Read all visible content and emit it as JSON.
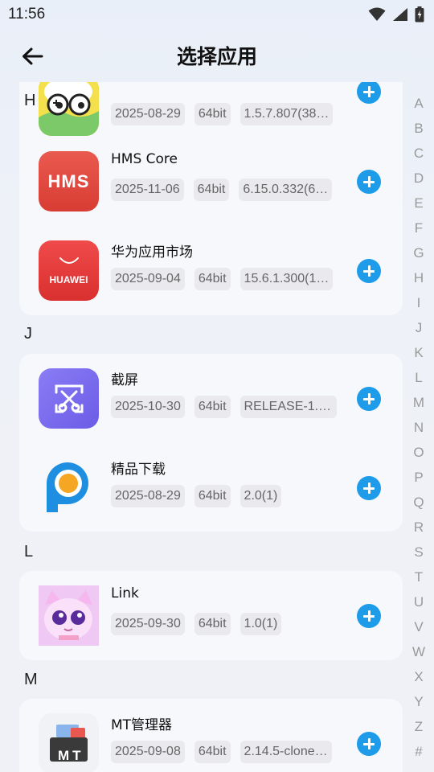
{
  "status": {
    "time": "11:56"
  },
  "header": {
    "title": "选择应用"
  },
  "sections": [
    {
      "letter": "H"
    },
    {
      "letter": "J"
    },
    {
      "letter": "L"
    },
    {
      "letter": "M"
    }
  ],
  "apps": [
    {
      "name": "",
      "date": "2025-08-29",
      "arch": "64bit",
      "version": "1.5.7.807(38…"
    },
    {
      "name": "HMS Core",
      "date": "2025-11-06",
      "arch": "64bit",
      "version": "6.15.0.332(6…",
      "icon_text": "HMS"
    },
    {
      "name": "华为应用市场",
      "date": "2025-09-04",
      "arch": "64bit",
      "version": "15.6.1.300(1…",
      "icon_text": "HUAWEI"
    },
    {
      "name": "截屏",
      "date": "2025-10-30",
      "arch": "64bit",
      "version": "RELEASE-1.6…"
    },
    {
      "name": "精品下载",
      "date": "2025-08-29",
      "arch": "64bit",
      "version": "2.0(1)"
    },
    {
      "name": "Link",
      "date": "2025-09-30",
      "arch": "64bit",
      "version": "1.0(1)"
    },
    {
      "name": "MT管理器",
      "date": "2025-09-08",
      "arch": "64bit",
      "version": "2.14.5-clone…",
      "icon_text": "MT"
    }
  ],
  "index_letters": [
    "A",
    "B",
    "C",
    "D",
    "E",
    "F",
    "G",
    "H",
    "I",
    "J",
    "K",
    "L",
    "M",
    "N",
    "O",
    "P",
    "Q",
    "R",
    "S",
    "T",
    "U",
    "V",
    "W",
    "X",
    "Y",
    "Z",
    "#"
  ],
  "colors": {
    "accent": "#1e9be9",
    "hms": "#e1493f",
    "huawei": "#e63b3b",
    "screenshot": "#7b6cf0"
  }
}
